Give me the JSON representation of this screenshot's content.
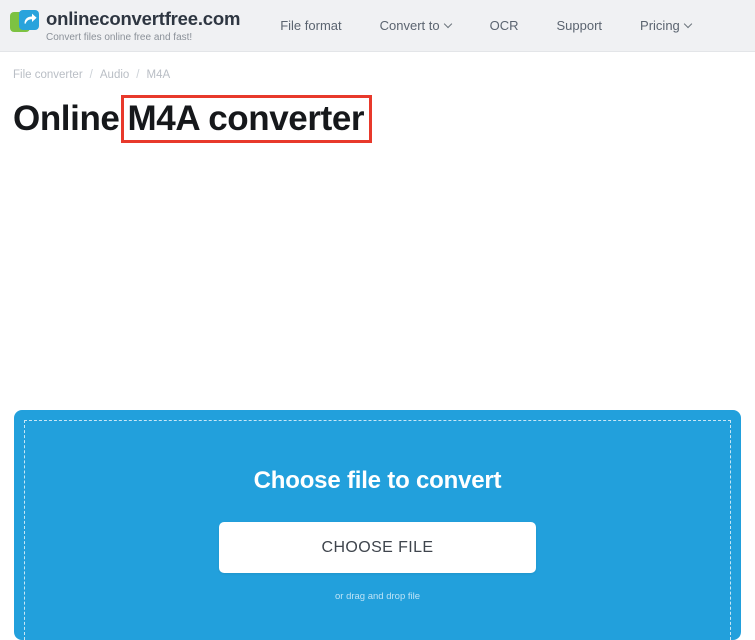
{
  "header": {
    "logo_icon": "convert-arrow-logo",
    "brand_name": "onlineconvertfree.com",
    "tagline": "Convert files online free and fast!",
    "nav": [
      {
        "label": "File format",
        "has_caret": false
      },
      {
        "label": "Convert to",
        "has_caret": true
      },
      {
        "label": "OCR",
        "has_caret": false
      },
      {
        "label": "Support",
        "has_caret": false
      },
      {
        "label": "Pricing",
        "has_caret": true
      }
    ]
  },
  "breadcrumb": {
    "items": [
      "File converter",
      "Audio",
      "M4A"
    ],
    "separator": "/"
  },
  "page": {
    "title_prefix": "Online",
    "title_highlighted": "M4A converter",
    "highlight_color": "#e8392b"
  },
  "upload": {
    "heading": "Choose file to convert",
    "button_label": "CHOOSE FILE",
    "drag_hint": "or drag and drop file",
    "panel_color": "#22a0dc"
  }
}
